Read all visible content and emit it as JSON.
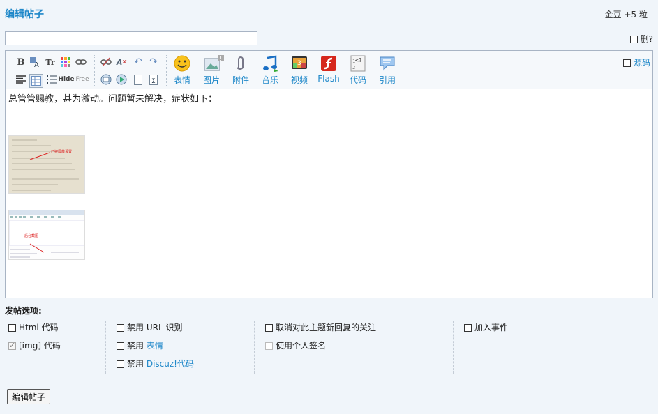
{
  "header": {
    "title": "编辑帖子",
    "coins": "金豆 +5 粒"
  },
  "subject": {
    "value": "",
    "placeholder": ""
  },
  "delete_label": "删?",
  "toolbar": {
    "small_buttons": [
      "bold-icon",
      "font-color-icon",
      "font-size-icon",
      "color-palette-icon",
      "link-icon",
      "unlink-icon",
      "remove-format-icon",
      "undo-icon",
      "redo-icon",
      "align-left-icon",
      "table-icon",
      "list-icon",
      "hide-icon",
      "free-icon",
      "insert-image-icon",
      "insert-media-icon",
      "page-icon",
      "sum-icon"
    ],
    "big_buttons": [
      {
        "label": "表情",
        "icon": "smiley-icon"
      },
      {
        "label": "图片",
        "icon": "image-icon"
      },
      {
        "label": "附件",
        "icon": "paperclip-icon"
      },
      {
        "label": "音乐",
        "icon": "music-icon"
      },
      {
        "label": "视频",
        "icon": "video-icon"
      },
      {
        "label": "Flash",
        "icon": "flash-icon"
      },
      {
        "label": "代码",
        "icon": "code-icon"
      },
      {
        "label": "引用",
        "icon": "quote-icon"
      }
    ],
    "source_label": "源码"
  },
  "content": {
    "text": "总管管赐教，甚为激动。问题暂未解决，症状如下：",
    "thumb1_note": "已被屏蔽设置",
    "thumb2_note": "后台截图"
  },
  "options": {
    "title": "发帖选项:",
    "col1": [
      {
        "label": "Html 代码",
        "checked": false
      },
      {
        "label": "[img] 代码",
        "checked": true,
        "disabled": true
      }
    ],
    "col2": [
      {
        "prefix": "禁用",
        "label": " URL 识别"
      },
      {
        "prefix": "禁用 ",
        "label": "表情"
      },
      {
        "prefix": "禁用 ",
        "label": "Discuz!代码"
      }
    ],
    "col3": [
      {
        "label": "取消对此主题新回复的关注"
      },
      {
        "label": "使用个人签名"
      }
    ],
    "col4": [
      {
        "label": "加入事件"
      }
    ]
  },
  "submit_label": "编辑帖子"
}
